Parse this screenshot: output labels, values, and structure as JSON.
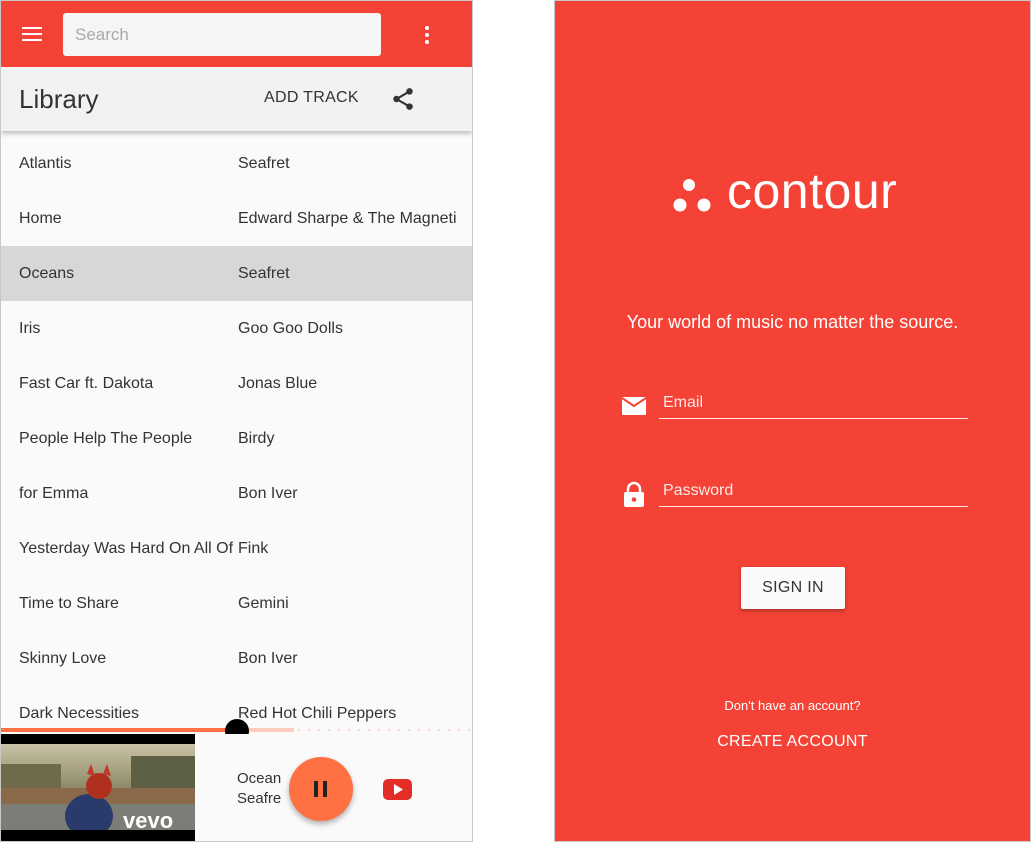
{
  "colors": {
    "brand_red": "#f44336",
    "accent_orange": "#ff7043",
    "selected_row": "#d7d7d7",
    "youtube_red": "#e52d27"
  },
  "library_screen": {
    "toolbar": {
      "menu_icon": "hamburger-menu-icon",
      "search_placeholder": "Search",
      "overflow_icon": "more-vert-icon"
    },
    "header": {
      "title": "Library",
      "add_track_label": "ADD TRACK",
      "share_icon": "share-icon"
    },
    "tracks": [
      {
        "title": "Atlantis",
        "artist": "Seafret"
      },
      {
        "title": "Home",
        "artist": "Edward Sharpe & The Magneti"
      },
      {
        "title": "Oceans",
        "artist": "Seafret"
      },
      {
        "title": "Iris",
        "artist": "Goo Goo Dolls"
      },
      {
        "title": "Fast Car ft. Dakota",
        "artist": "Jonas Blue"
      },
      {
        "title": "People Help The People",
        "artist": "Birdy"
      },
      {
        "title": "for Emma",
        "artist": "Bon Iver"
      },
      {
        "title": "Yesterday Was Hard On All Of",
        "artist": "Fink"
      },
      {
        "title": "Time to Share",
        "artist": "Gemini"
      },
      {
        "title": "Skinny Love",
        "artist": "Bon Iver"
      },
      {
        "title": "Dark Necessities",
        "artist": "Red Hot Chili Peppers"
      }
    ],
    "selected_track_index": 2,
    "player": {
      "progress": 0.5,
      "buffered": 0.62,
      "now_playing_title": "Oceans",
      "now_playing_artist": "Seafret",
      "video_watermark": "vevo",
      "pause_icon": "pause-icon",
      "source_icon": "youtube-icon"
    }
  },
  "login_screen": {
    "logo_text": "contour",
    "tagline": "Your world of music no matter the source.",
    "email_placeholder": "Email",
    "email_icon": "mail-icon",
    "password_placeholder": "Password",
    "password_icon": "lock-icon",
    "sign_in_label": "SIGN IN",
    "no_account_text": "Don't have an account?",
    "create_account_label": "CREATE ACCOUNT"
  }
}
